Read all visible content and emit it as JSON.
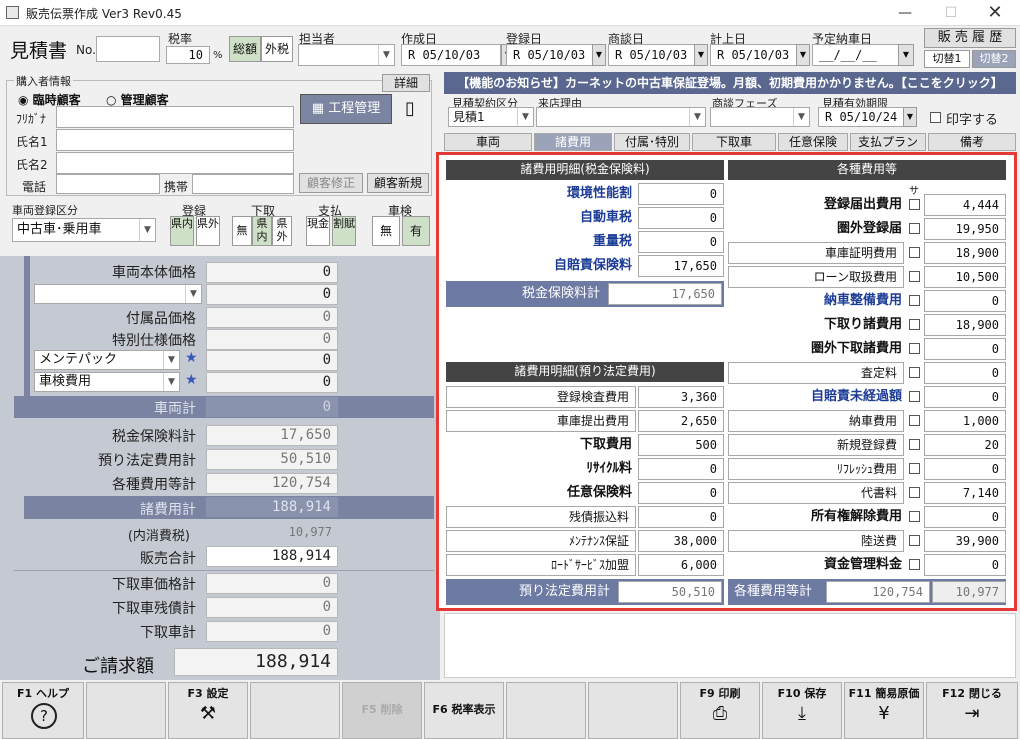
{
  "window": {
    "title": "販売伝票作成 Ver3 Rev0.45",
    "sales_history_button": "販 売 履 歴",
    "switch1": "切替1",
    "switch2": "切替2"
  },
  "header": {
    "doc_type": "見積書",
    "no_label": "No.",
    "no_value": "",
    "tax_rate_label": "税率",
    "tax_rate_value": "10",
    "percent": "%",
    "tax_incl": "総額",
    "tax_excl": "外税",
    "staff_label": "担当者",
    "created_label": "作成日",
    "created_value": "R 05/10/03",
    "registered_label": "登録日",
    "registered_value": "R 05/10/03",
    "negotiated_label": "商談日",
    "negotiated_value": "R 05/10/03",
    "recorded_label": "計上日",
    "recorded_value": "R 05/10/03",
    "delivery_label": "予定納車日",
    "delivery_value": "__/__/__"
  },
  "buyer": {
    "section_label": "購入者情報",
    "detail_button": "詳細",
    "radio_temp": "臨時顧客",
    "radio_managed": "管理顧客",
    "furigana_label": "ﾌﾘｶﾞﾅ",
    "name1_label": "氏名1",
    "name2_label": "氏名2",
    "phone_label": "電話",
    "mobile_label": "携帯",
    "process_button": "工程管理",
    "edit_customer_button": "顧客修正",
    "new_customer_button": "顧客新規"
  },
  "vehicle_reg": {
    "label": "車両登録区分",
    "value": "中古車･乗用車",
    "reg_label": "登録",
    "reg_in": "県内",
    "reg_out": "県外",
    "trade_label": "下取",
    "trade_none": "無",
    "trade_in": "県内",
    "trade_out": "県外",
    "pay_label": "支払",
    "pay_cash": "現金",
    "pay_install": "割賦",
    "inspect_label": "車検",
    "inspect_none": "無",
    "inspect_yes": "有"
  },
  "left_totals": {
    "body_price_label": "車両本体価格",
    "body_price": "0",
    "option_value": "0",
    "accessories_label": "付属品価格",
    "accessories": "0",
    "special_label": "特別仕様価格",
    "special": "0",
    "pack1_select": "メンテパック",
    "pack1_value": "0",
    "pack2_select": "車検費用",
    "pack2_value": "0",
    "star": "★",
    "vehicle_total_label": "車両計",
    "vehicle_total": "0",
    "tax_ins_label": "税金保険料計",
    "tax_ins": "17,650",
    "deposit_label": "預り法定費用計",
    "deposit": "50,510",
    "misc_label": "各種費用等計",
    "misc": "120,754",
    "expenses_label": "諸費用計",
    "expenses": "188,914",
    "consumption_label": "(内消費税)",
    "consumption": "10,977",
    "sales_total_label": "販売合計",
    "sales_total": "188,914",
    "tradein_price_label": "下取車価格計",
    "tradein_price": "0",
    "tradein_debt_label": "下取車残債計",
    "tradein_debt": "0",
    "tradein_total_label": "下取車計",
    "tradein_total": "0",
    "invoice_label": "ご請求額",
    "invoice": "188,914"
  },
  "notice": "【機能のお知らせ】カーネットの中古車保証登場。月額、初期費用かかりません。【ここをクリック】",
  "contract": {
    "contract_label": "見積契約区分",
    "contract_value": "見積1",
    "visit_label": "来店理由",
    "phase_label": "商談フェーズ",
    "valid_label": "見積有効期限",
    "valid_value": "R 05/10/24",
    "seal_label": "印字する"
  },
  "tabs": [
    "車両",
    "諸費用",
    "付属･特別",
    "下取車",
    "任意保険",
    "支払プラン",
    "備考"
  ],
  "expenses_panel": {
    "tax_head": "諸費用明細(税金保険料)",
    "tax_rows": [
      {
        "label": "環境性能割",
        "value": "0"
      },
      {
        "label": "自動車税",
        "value": "0"
      },
      {
        "label": "重量税",
        "value": "0"
      },
      {
        "label": "自賠責保険料",
        "value": "17,650"
      }
    ],
    "tax_total_label": "税金保険料計",
    "tax_total": "17,650",
    "legal_head": "諸費用明細(預り法定費用)",
    "legal_rows": [
      {
        "label": "登録検査費用",
        "value": "3,360"
      },
      {
        "label": "車庫提出費用",
        "value": "2,650"
      },
      {
        "label": "下取費用",
        "value": "500"
      },
      {
        "label": "ﾘｻｲｸﾙ料",
        "value": "0"
      },
      {
        "label": "任意保険料",
        "value": "0"
      },
      {
        "label": "残債振込料",
        "value": "0"
      },
      {
        "label": "ﾒﾝﾃﾅﾝｽ保証",
        "value": "38,000"
      },
      {
        "label": "ﾛｰﾄﾞｻｰﾋﾞｽ加盟",
        "value": "6,000"
      }
    ],
    "legal_total_label": "預り法定費用計",
    "legal_total": "50,510",
    "misc_head": "各種費用等",
    "sa_label": "サ",
    "misc_rows": [
      {
        "label": "登録届出費用",
        "value": "4,444"
      },
      {
        "label": "圏外登録届",
        "value": "19,950"
      },
      {
        "label": "車庫証明費用",
        "value": "18,900"
      },
      {
        "label": "ローン取扱費用",
        "value": "10,500"
      },
      {
        "label": "納車整備費用",
        "value": "0"
      },
      {
        "label": "下取り諸費用",
        "value": "18,900"
      },
      {
        "label": "圏外下取諸費用",
        "value": "0"
      },
      {
        "label": "査定料",
        "value": "0"
      },
      {
        "label": "自賠責未経過額",
        "value": "0"
      },
      {
        "label": "納車費用",
        "value": "1,000"
      },
      {
        "label": "新規登録費",
        "value": "20"
      },
      {
        "label": "ﾘﾌﾚｯｼｭ費用",
        "value": "0"
      },
      {
        "label": "代書料",
        "value": "7,140"
      },
      {
        "label": "所有権解除費用",
        "value": "0"
      },
      {
        "label": "陸送費",
        "value": "39,900"
      },
      {
        "label": "資金管理料金",
        "value": "0"
      }
    ],
    "misc_total_label": "各種費用等計",
    "misc_total": "120,754",
    "misc_tax": "10,977"
  },
  "fkeys": [
    {
      "key": "F1 ヘルプ",
      "icon": "?"
    },
    {
      "key": "",
      "icon": ""
    },
    {
      "key": "F3 設定",
      "icon": "⚒"
    },
    {
      "key": "",
      "icon": ""
    },
    {
      "key": "F5 削除",
      "icon": ""
    },
    {
      "key": "F6 税率表示",
      "icon": ""
    },
    {
      "key": "",
      "icon": ""
    },
    {
      "key": "",
      "icon": ""
    },
    {
      "key": "F9 印刷",
      "icon": "⎙"
    },
    {
      "key": "F10 保存",
      "icon": "⤓"
    },
    {
      "key": "F11 簡易原価",
      "icon": "¥"
    },
    {
      "key": "F12 閉じる",
      "icon": "⇥"
    }
  ]
}
